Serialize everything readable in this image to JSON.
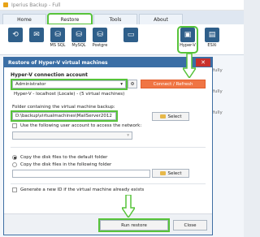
{
  "app": {
    "title": "Iperius Backup - Full",
    "tabs": [
      {
        "label": "Home"
      },
      {
        "label": "Restore"
      },
      {
        "label": "Tools"
      },
      {
        "label": "About"
      }
    ],
    "ribbon": [
      {
        "label": ""
      },
      {
        "label": ""
      },
      {
        "label": "MS SQL"
      },
      {
        "label": "MySQL"
      },
      {
        "label": "Postgre"
      },
      {
        "label": ""
      },
      {
        "label": "Hyper-V"
      },
      {
        "label": "ESXi"
      }
    ],
    "bg_text": [
      "fully",
      "fully",
      "fully"
    ]
  },
  "dialog": {
    "title": "Restore of Hyper-V virtual machines",
    "connection_section": "Hyper-V connection account",
    "account_value": "Administrator",
    "connect_button": "Connect / Refresh",
    "connection_info": "Hyper-V - localhost (Locale) - (5 virtual machines)",
    "folder_label": "Folder containing the virtual machine backup:",
    "folder_value": "D:\\backup\\virtualmachines\\MailServer2012",
    "select_label": "Select",
    "use_account_label": "Use the following user account to access the network:",
    "copy_default_label": "Copy the disk files to the default folder",
    "copy_folder_label": "Copy the disk files in the following folder",
    "generate_id_label": "Generate a new ID if the virtual machine already exists",
    "run_restore_label": "Run restore",
    "close_label": "Close"
  }
}
